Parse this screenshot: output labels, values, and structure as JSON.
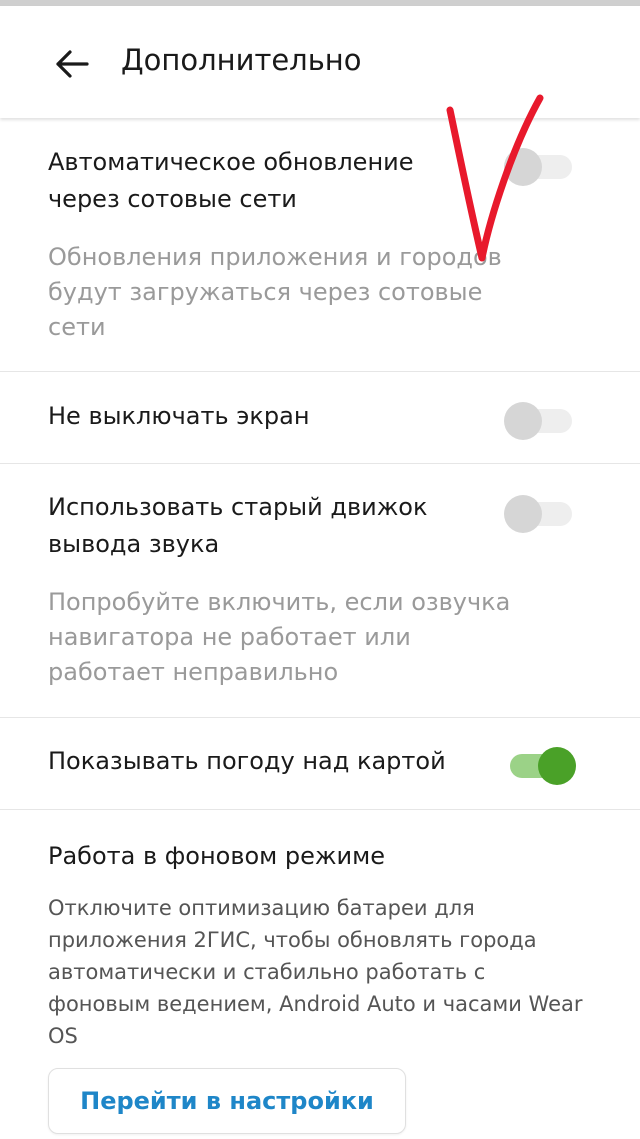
{
  "header": {
    "title": "Дополнительно",
    "back_icon": "arrow-left-icon"
  },
  "settings": [
    {
      "label": "Автоматическое обновление через сотовые сети",
      "description": "Обновления приложения и городов будут загружаться через сотовые сети",
      "enabled": false
    },
    {
      "label": "Не выключать экран",
      "enabled": false
    },
    {
      "label": "Использовать старый движок вывода звука",
      "description": "Попробуйте включить, если озвучка навигатора не работает или работает неправильно",
      "enabled": false
    },
    {
      "label": "Показывать погоду над картой",
      "enabled": true
    }
  ],
  "background_mode": {
    "title": "Работа в фоновом режиме",
    "description": "Отключите оптимизацию батареи для приложения 2ГИС, чтобы обновлять города автоматически и стабильно работать с фоновым ведением, Android Auto и часами Wear OS",
    "button_label": "Перейти в настройки"
  },
  "colors": {
    "toggle_on_thumb": "#4aa128",
    "toggle_on_track": "#9bd287",
    "toggle_off_thumb": "#d6d6d6",
    "link_blue": "#1e86c8",
    "annotation_red": "#e8192c"
  }
}
